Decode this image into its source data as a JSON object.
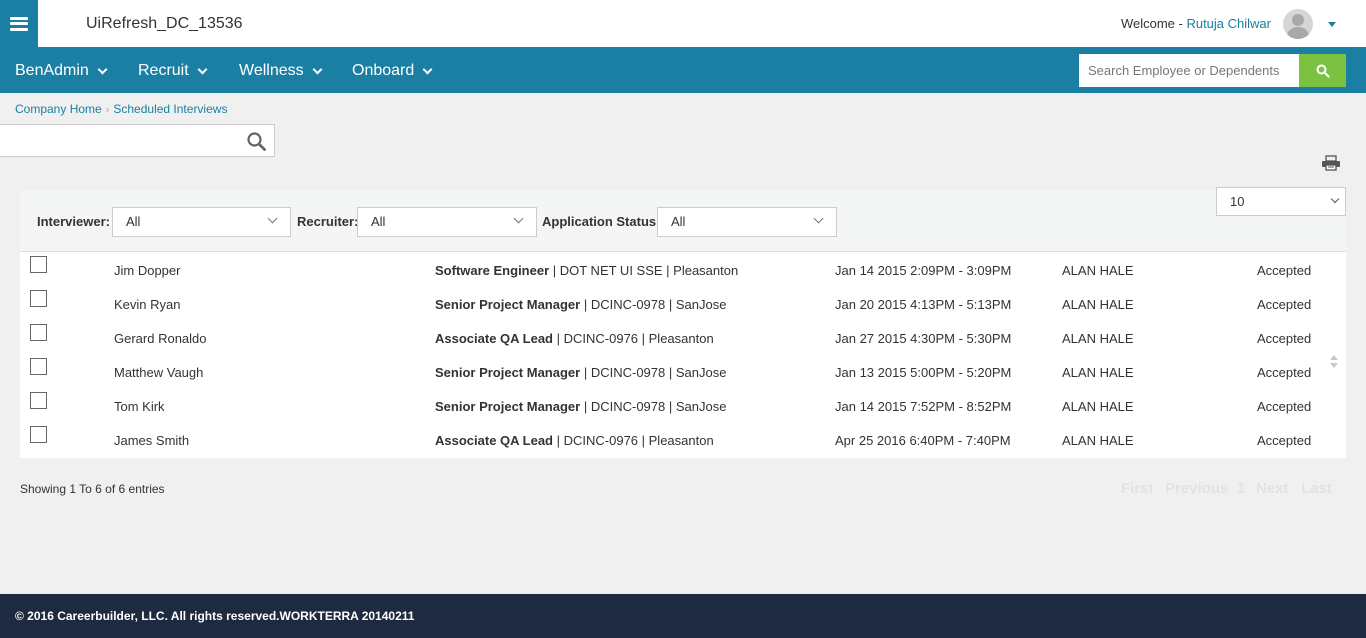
{
  "header": {
    "app_title": "UiRefresh_DC_13536",
    "welcome_label": "Welcome -",
    "user_name": "Rutuja Chilwar"
  },
  "nav": {
    "items": [
      {
        "label": "BenAdmin"
      },
      {
        "label": "Recruit"
      },
      {
        "label": "Wellness"
      },
      {
        "label": "Onboard"
      }
    ],
    "search_placeholder": "Search Employee or Dependents"
  },
  "breadcrumb": [
    "Company Home",
    "Scheduled Interviews"
  ],
  "filters": {
    "interviewer_label": "Interviewer:",
    "interviewer_value": "All",
    "recruiter_label": "Recruiter:",
    "recruiter_value": "All",
    "status_label": "Application Status:",
    "status_value": "All",
    "page_size": "10"
  },
  "rows": [
    {
      "name": "Jim Dopper",
      "job_title": "Software Engineer",
      "job_detail": " | DOT NET UI SSE | Pleasanton",
      "schedule": "Jan 14 2015 2:09PM - 3:09PM",
      "interviewer": "ALAN HALE",
      "status": "Accepted"
    },
    {
      "name": "Kevin Ryan",
      "job_title": "Senior Project Manager",
      "job_detail": " | DCINC-0978 | SanJose",
      "schedule": "Jan 20 2015 4:13PM - 5:13PM",
      "interviewer": "ALAN HALE",
      "status": "Accepted"
    },
    {
      "name": "Gerard Ronaldo",
      "job_title": "Associate QA Lead",
      "job_detail": " | DCINC-0976 | Pleasanton",
      "schedule": "Jan 27 2015 4:30PM - 5:30PM",
      "interviewer": "ALAN HALE",
      "status": "Accepted"
    },
    {
      "name": "Matthew Vaugh",
      "job_title": "Senior Project Manager",
      "job_detail": " | DCINC-0978 | SanJose",
      "schedule": "Jan 13 2015 5:00PM - 5:20PM",
      "interviewer": "ALAN HALE",
      "status": "Accepted"
    },
    {
      "name": "Tom Kirk",
      "job_title": "Senior Project Manager",
      "job_detail": " | DCINC-0978 | SanJose",
      "schedule": "Jan 14 2015 7:52PM - 8:52PM",
      "interviewer": "ALAN HALE",
      "status": "Accepted"
    },
    {
      "name": "James Smith",
      "job_title": "Associate QA Lead",
      "job_detail": " | DCINC-0976 | Pleasanton",
      "schedule": "Apr 25 2016 6:40PM - 7:40PM",
      "interviewer": "ALAN HALE",
      "status": "Accepted"
    }
  ],
  "summary": "Showing 1 To 6 of 6 entries",
  "pager": {
    "first": "First",
    "previous": "Previous",
    "page": "1",
    "next": "Next",
    "last": "Last"
  },
  "footer": {
    "text": "© 2016 Careerbuilder, LLC. All rights reserved.WORKTERRA 20140211"
  },
  "colors": {
    "brand": "#1a7fa3",
    "search_button": "#7cc242",
    "footer": "#1d2a3f"
  },
  "icons": [
    "menu-icon",
    "avatar-icon",
    "caret-down-icon",
    "search-icon",
    "print-icon",
    "sort-icon"
  ]
}
